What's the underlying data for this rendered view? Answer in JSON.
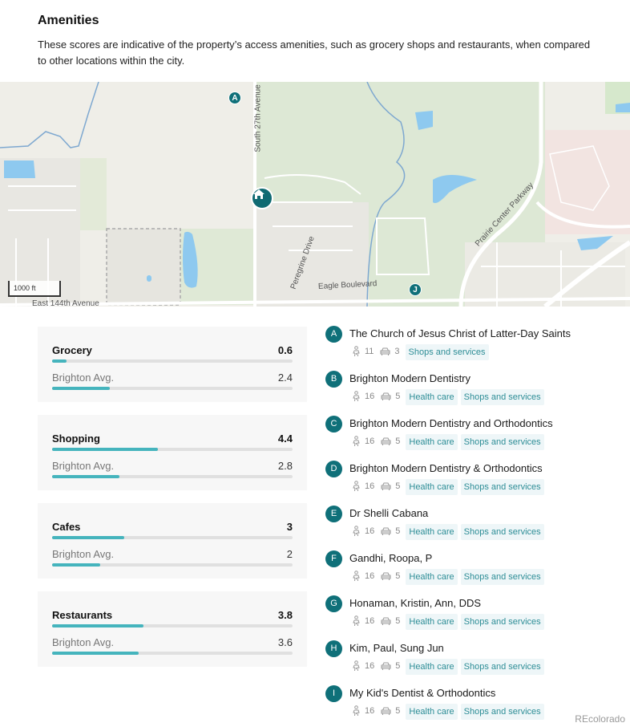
{
  "header": {
    "title": "Amenities",
    "description": "These scores are indicative of the property’s access amenities, such as grocery shops and restaurants, when compared to other locations within the city."
  },
  "map": {
    "scale_label": "1000 ft",
    "street_labels": [
      "South 27th Avenue",
      "Peregrine Drive",
      "Eagle Boulevard",
      "Prairie Center Parkway",
      "East 144th Avenue"
    ],
    "pins": [
      {
        "letter": "A"
      },
      {
        "letter": "J"
      }
    ],
    "home_icon": "home-icon",
    "colors": {
      "pin": "#0f7079",
      "water": "#8ec9ef",
      "park": "#dde8d5",
      "land": "#efeee8"
    }
  },
  "scores": {
    "scale_max": 10,
    "bar_color": "#45b4bd",
    "categories": [
      {
        "name": "Grocery",
        "value": 0.6,
        "avg_label": "Brighton Avg.",
        "avg_value": 2.4
      },
      {
        "name": "Shopping",
        "value": 4.4,
        "avg_label": "Brighton Avg.",
        "avg_value": 2.8
      },
      {
        "name": "Cafes",
        "value": 3,
        "avg_label": "Brighton Avg.",
        "avg_value": 2
      },
      {
        "name": "Restaurants",
        "value": 3.8,
        "avg_label": "Brighton Avg.",
        "avg_value": 3.6
      }
    ]
  },
  "places": [
    {
      "letter": "A",
      "name": "The Church of Jesus Christ of Latter-Day Saints",
      "walk": "11",
      "drive": "3",
      "tags": [
        "Shops and services"
      ]
    },
    {
      "letter": "B",
      "name": "Brighton Modern Dentistry",
      "walk": "16",
      "drive": "5",
      "tags": [
        "Health care",
        "Shops and services"
      ]
    },
    {
      "letter": "C",
      "name": "Brighton Modern Dentistry and Orthodontics",
      "walk": "16",
      "drive": "5",
      "tags": [
        "Health care",
        "Shops and services"
      ]
    },
    {
      "letter": "D",
      "name": "Brighton Modern Dentistry & Orthodontics",
      "walk": "16",
      "drive": "5",
      "tags": [
        "Health care",
        "Shops and services"
      ]
    },
    {
      "letter": "E",
      "name": "Dr Shelli Cabana",
      "walk": "16",
      "drive": "5",
      "tags": [
        "Health care",
        "Shops and services"
      ]
    },
    {
      "letter": "F",
      "name": "Gandhi, Roopa, P",
      "walk": "16",
      "drive": "5",
      "tags": [
        "Health care",
        "Shops and services"
      ]
    },
    {
      "letter": "G",
      "name": "Honaman, Kristin, Ann, DDS",
      "walk": "16",
      "drive": "5",
      "tags": [
        "Health care",
        "Shops and services"
      ]
    },
    {
      "letter": "H",
      "name": "Kim, Paul, Sung Jun",
      "walk": "16",
      "drive": "5",
      "tags": [
        "Health care",
        "Shops and services"
      ]
    },
    {
      "letter": "I",
      "name": "My Kid's Dentist & Orthodontics",
      "walk": "16",
      "drive": "5",
      "tags": [
        "Health care",
        "Shops and services"
      ]
    }
  ],
  "footer": {
    "brand": "REcolorado"
  }
}
